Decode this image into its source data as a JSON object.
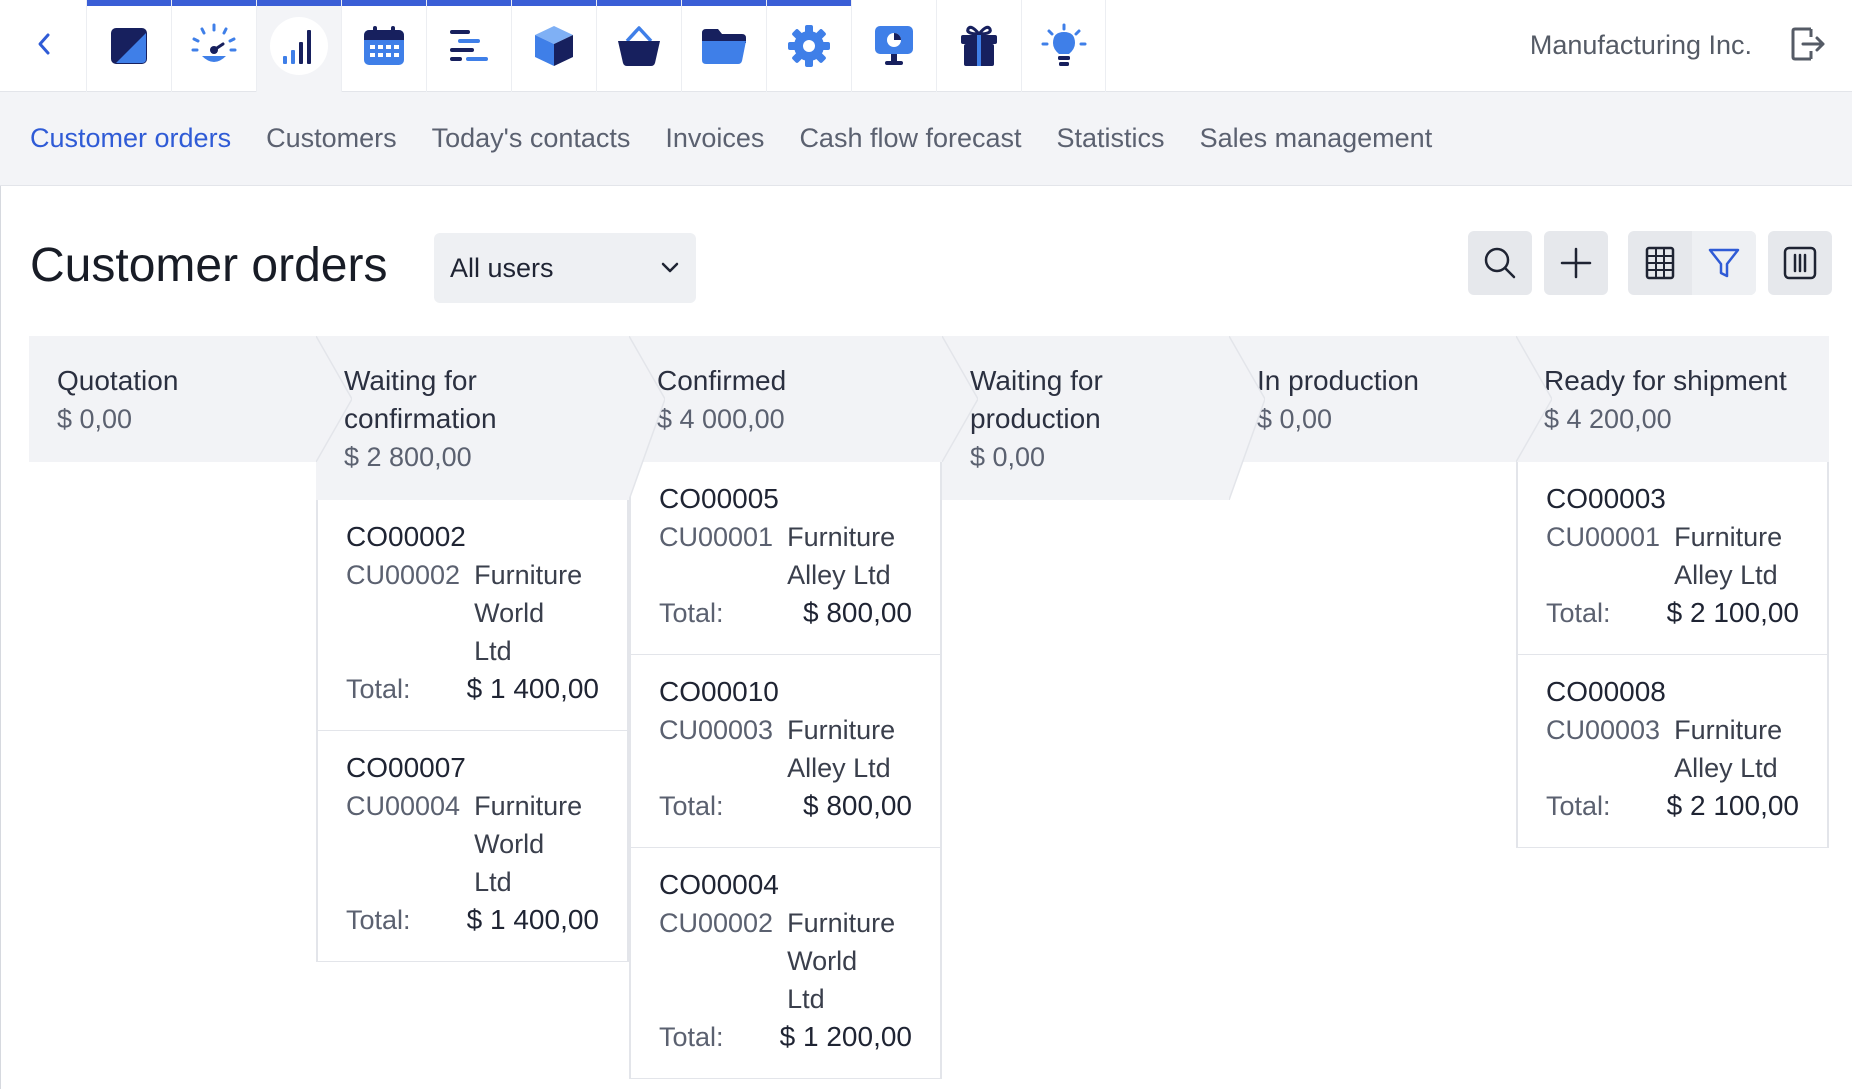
{
  "app": {
    "company": "Manufacturing Inc.",
    "apps": [
      {
        "icon": "quick-tile-icon"
      },
      {
        "icon": "dashboard-gauge-icon"
      },
      {
        "icon": "sales-bar-chart-icon"
      },
      {
        "icon": "calendar-icon"
      },
      {
        "icon": "task-list-icon"
      },
      {
        "icon": "inventory-box-icon"
      },
      {
        "icon": "shopping-basket-icon"
      },
      {
        "icon": "folder-icon"
      },
      {
        "icon": "settings-gear-icon"
      },
      {
        "icon": "presentation-icon"
      },
      {
        "icon": "gift-icon"
      },
      {
        "icon": "lightbulb-icon"
      }
    ]
  },
  "subnav": {
    "tabs": [
      "Customer orders",
      "Customers",
      "Today's contacts",
      "Invoices",
      "Cash flow forecast",
      "Statistics",
      "Sales management"
    ],
    "active": "Customer orders"
  },
  "page": {
    "title": "Customer orders",
    "user_filter": "All users"
  },
  "colors": {
    "accent": "#2f5bd6",
    "app_bar_highlight": "#3a5ed6"
  },
  "columns": [
    {
      "name": "Quotation",
      "amount": "$ 0,00",
      "cards": []
    },
    {
      "name": "Waiting for confirmation",
      "amount": "$ 2 800,00",
      "cards": [
        {
          "id": "CO00002",
          "customer_no": "CU00002",
          "customer": "Furniture World Ltd",
          "total_label": "Total:",
          "total": "$ 1 400,00"
        },
        {
          "id": "CO00007",
          "customer_no": "CU00004",
          "customer": "Furniture World Ltd",
          "total_label": "Total:",
          "total": "$ 1 400,00"
        }
      ]
    },
    {
      "name": "Confirmed",
      "amount": "$ 4 000,00",
      "cards": [
        {
          "id": "CO00005",
          "customer_no": "CU00001",
          "customer": "Furniture Alley Ltd",
          "total_label": "Total:",
          "total": "$ 800,00"
        },
        {
          "id": "CO00010",
          "customer_no": "CU00003",
          "customer": "Furniture Alley Ltd",
          "total_label": "Total:",
          "total": "$ 800,00"
        },
        {
          "id": "CO00004",
          "customer_no": "CU00002",
          "customer": "Furniture World Ltd",
          "total_label": "Total:",
          "total": "$ 1 200,00"
        }
      ]
    },
    {
      "name": "Waiting for production",
      "amount": "$ 0,00",
      "cards": []
    },
    {
      "name": "In production",
      "amount": "$ 0,00",
      "cards": []
    },
    {
      "name": "Ready for shipment",
      "amount": "$ 4 200,00",
      "cards": [
        {
          "id": "CO00003",
          "customer_no": "CU00001",
          "customer": "Furniture Alley Ltd",
          "total_label": "Total:",
          "total": "$ 2 100,00"
        },
        {
          "id": "CO00008",
          "customer_no": "CU00003",
          "customer": "Furniture Alley Ltd",
          "total_label": "Total:",
          "total": "$ 2 100,00"
        }
      ]
    }
  ]
}
